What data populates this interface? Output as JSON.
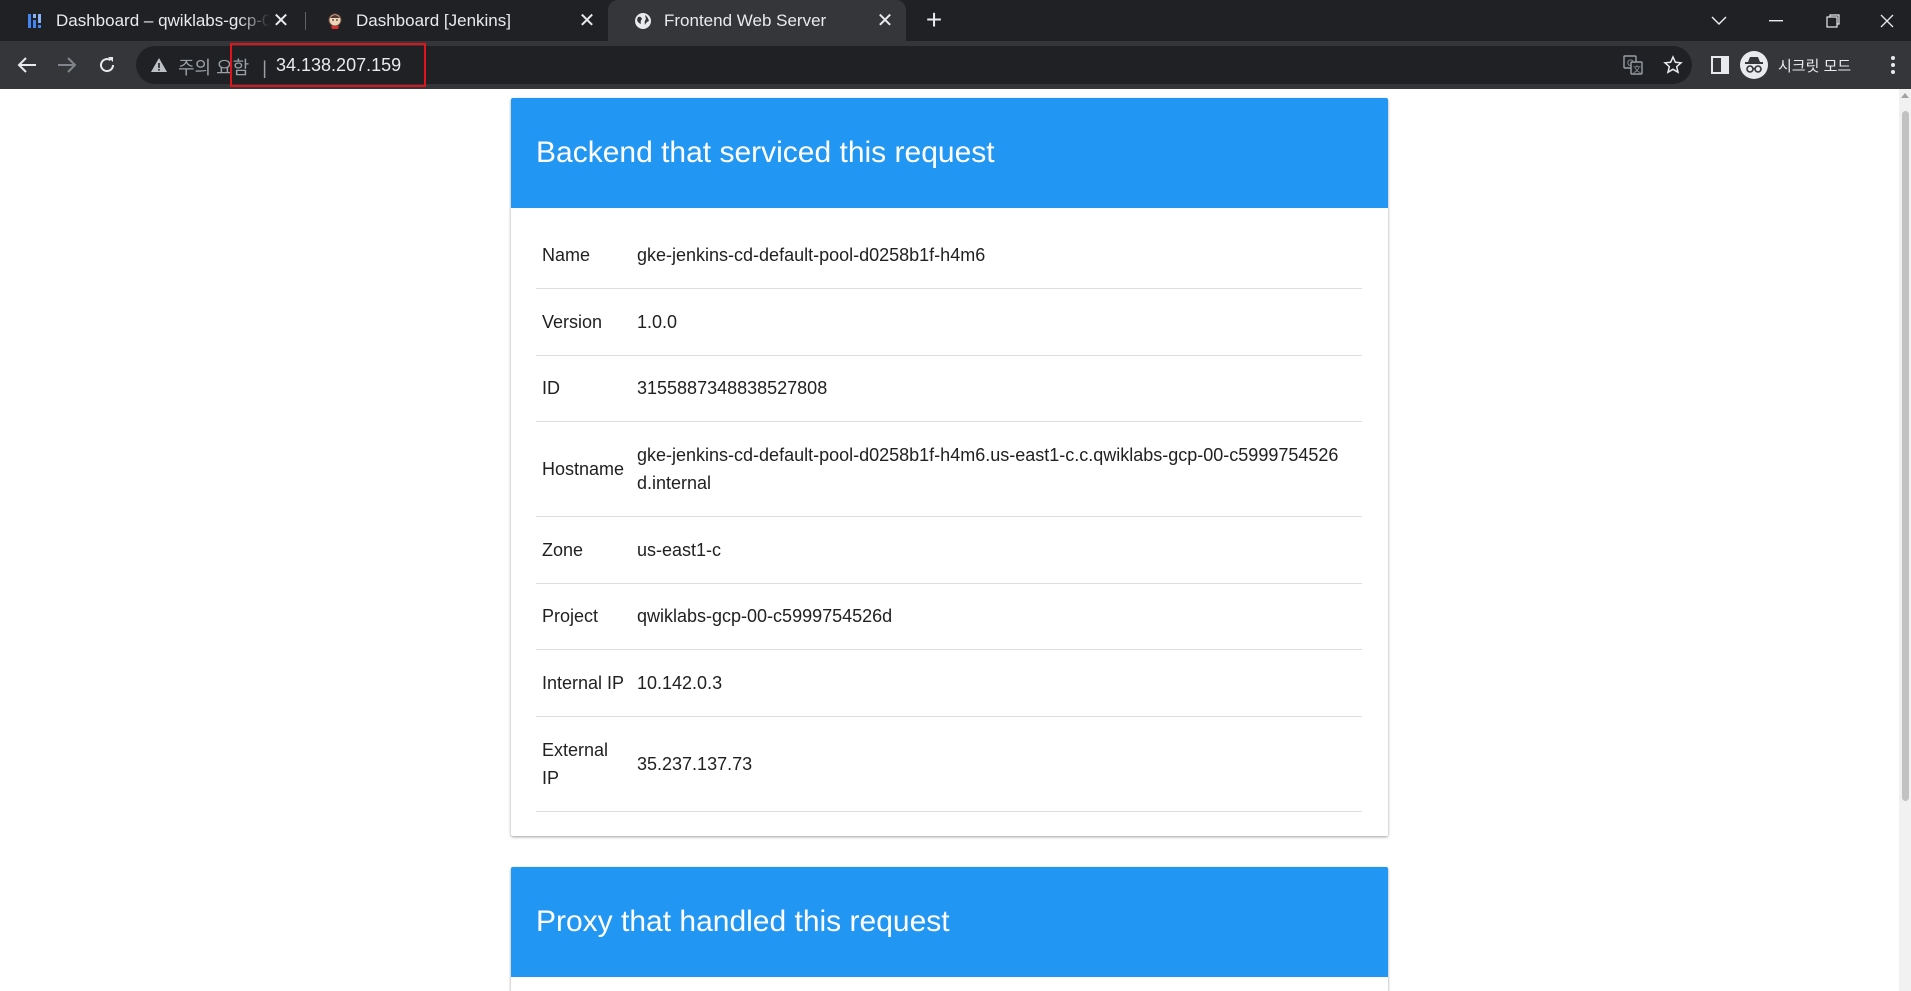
{
  "browser": {
    "tabs": [
      {
        "title": "Dashboard – qwiklabs-gcp-00-c5999754526d",
        "icon": "grid-dashboard-icon",
        "active": false
      },
      {
        "title": "Dashboard [Jenkins]",
        "icon": "jenkins-icon",
        "active": false
      },
      {
        "title": "Frontend Web Server",
        "icon": "globe-icon",
        "active": true
      }
    ],
    "new_tab_glyph": "+",
    "close_glyph": "✕",
    "security_warning": "주의 요함",
    "url_separator": "|",
    "url": "34.138.207.159",
    "incognito_label": "시크릿 모드",
    "highlight_color": "#e0141c"
  },
  "page": {
    "accent_color": "#2196f3",
    "backend": {
      "heading": "Backend that serviced this request",
      "rows": [
        {
          "key": "Name",
          "value": "gke-jenkins-cd-default-pool-d0258b1f-h4m6"
        },
        {
          "key": "Version",
          "value": "1.0.0"
        },
        {
          "key": "ID",
          "value": "3155887348838527808"
        },
        {
          "key": "Hostname",
          "value": "gke-jenkins-cd-default-pool-d0258b1f-h4m6.us-east1-c.c.qwiklabs-gcp-00-c5999754526d.internal"
        },
        {
          "key": "Zone",
          "value": "us-east1-c"
        },
        {
          "key": "Project",
          "value": "qwiklabs-gcp-00-c5999754526d"
        },
        {
          "key": "Internal IP",
          "value": "10.142.0.3"
        },
        {
          "key": "External IP",
          "value": "35.237.137.73"
        }
      ]
    },
    "proxy": {
      "heading": "Proxy that handled this request"
    }
  }
}
